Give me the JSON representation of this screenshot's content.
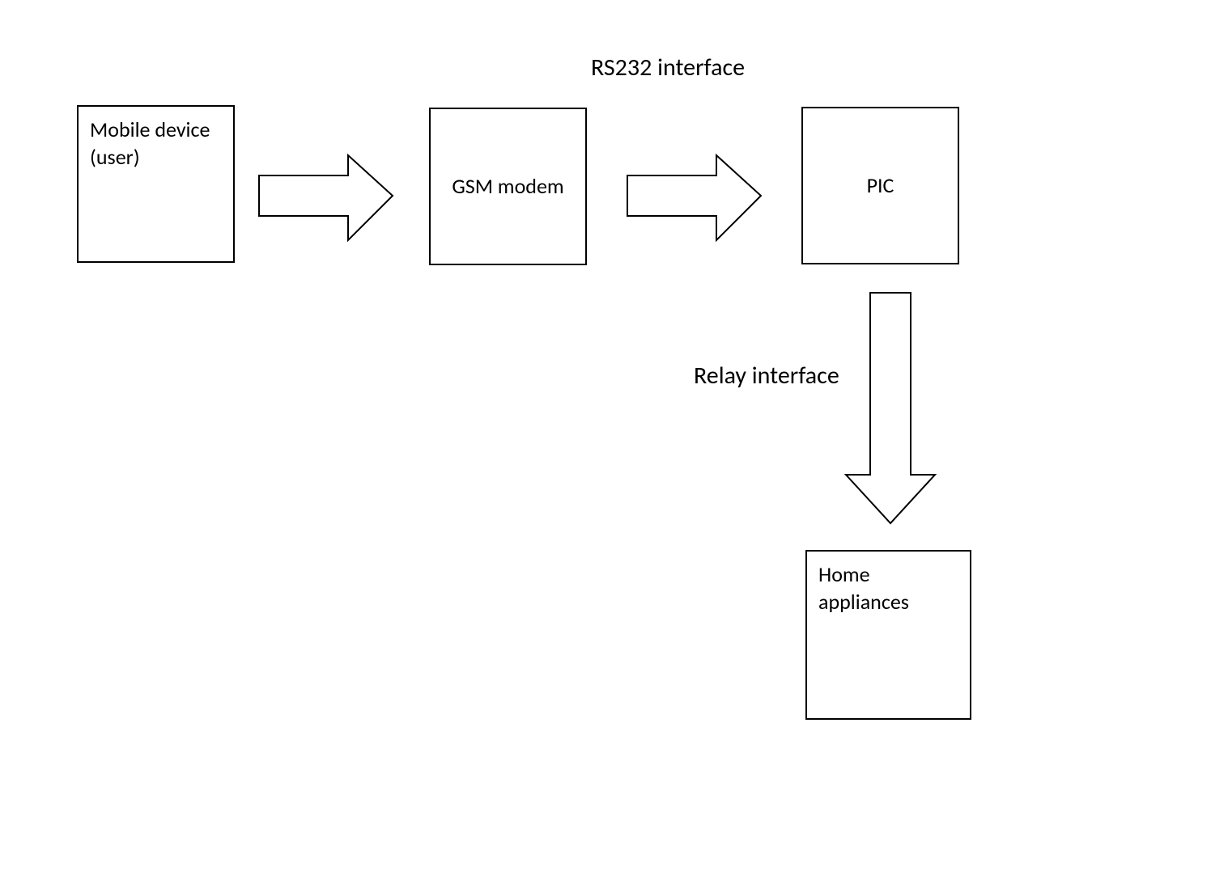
{
  "labels": {
    "rs232": "RS232 interface",
    "relay": "Relay interface"
  },
  "boxes": {
    "mobile": "Mobile device (user)",
    "gsm": "GSM modem",
    "pic": "PIC",
    "home": "Home appliances"
  }
}
